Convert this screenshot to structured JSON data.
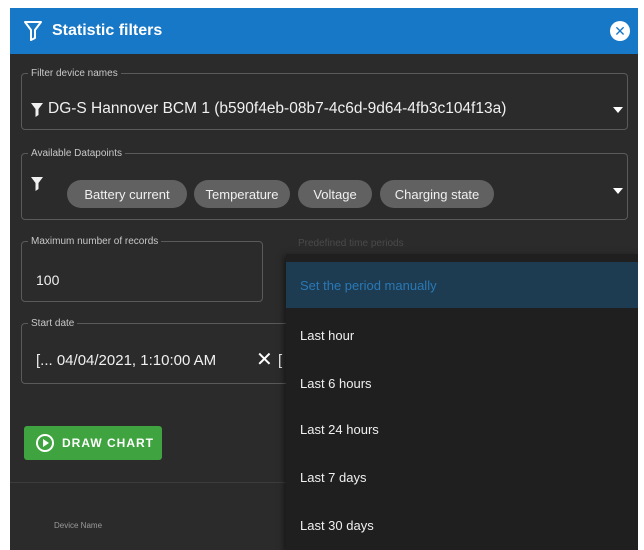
{
  "dialog": {
    "title": "Statistic filters",
    "close_icon": "close-circle-icon",
    "title_icon": "filter-icon",
    "accent_color": "#1778c7"
  },
  "device_filter": {
    "label": "Filter device names",
    "value": "DG-S Hannover BCM 1 (b590f4eb-08b7-4c6d-9d64-4fb3c104f13a)"
  },
  "datapoints": {
    "label": "Available Datapoints",
    "chips": [
      "Battery current",
      "Temperature",
      "Voltage",
      "Charging state"
    ]
  },
  "max_records": {
    "label": "Maximum number of records",
    "value": "100"
  },
  "timespan": {
    "label": "Predefined time periods"
  },
  "start_date": {
    "label": "Start date",
    "value": "[... 04/04/2021, 1:10:00 AM",
    "clear_symbol": "✕",
    "trailing": "["
  },
  "draw_button": {
    "label": "DRAW CHART",
    "color": "#3fa33f"
  },
  "table": {
    "column_device_name": "Device Name"
  },
  "period_menu": {
    "items": [
      "Set the period manually",
      "Last hour",
      "Last 6 hours",
      "Last 24 hours",
      "Last 7 days",
      "Last 30 days"
    ],
    "selected_index": 0
  }
}
